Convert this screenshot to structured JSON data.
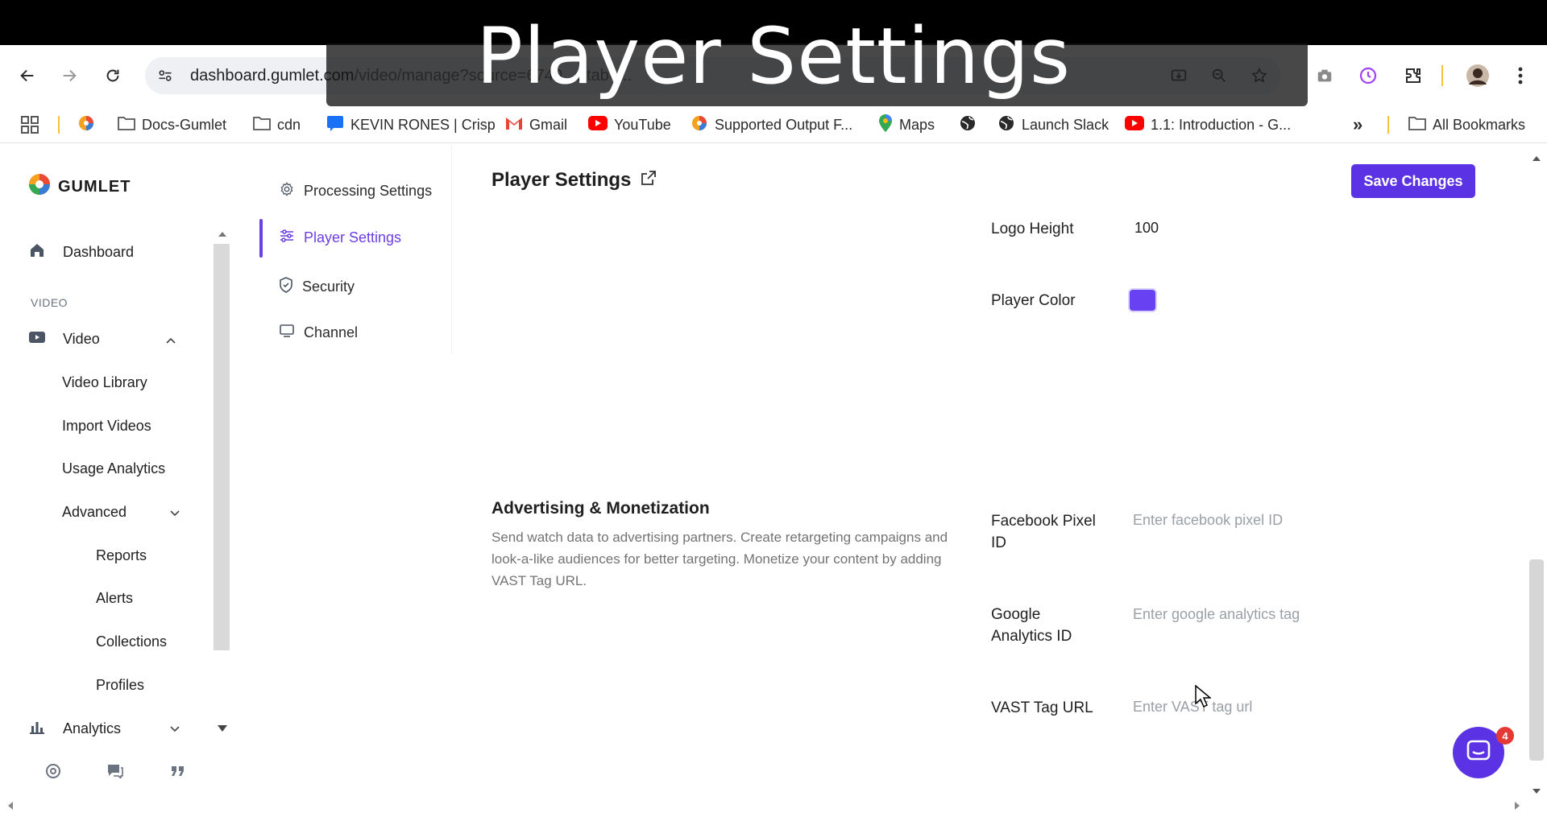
{
  "overlay": {
    "title": "Player Settings"
  },
  "browser": {
    "url_host": "dashboard.gumlet.com",
    "url_path": "/video/manage?source=6740...&tab=...",
    "bookmarks": [
      {
        "label": "",
        "icon": "chrome-icon"
      },
      {
        "label": "Docs-Gumlet",
        "icon": "folder-icon"
      },
      {
        "label": "cdn",
        "icon": "folder-icon"
      },
      {
        "label": "KEVIN RONES | Crisp",
        "icon": "crisp-icon"
      },
      {
        "label": "Gmail",
        "icon": "gmail-icon"
      },
      {
        "label": "YouTube",
        "icon": "youtube-icon"
      },
      {
        "label": "Supported Output F...",
        "icon": "gumlet-icon"
      },
      {
        "label": "Maps",
        "icon": "maps-icon"
      },
      {
        "label": "",
        "icon": "globe-icon"
      },
      {
        "label": "Launch Slack",
        "icon": "globe-icon"
      },
      {
        "label": "1.1: Introduction - G...",
        "icon": "youtube-icon"
      }
    ],
    "more_label": "»",
    "all_bookmarks": "All Bookmarks"
  },
  "sidebar": {
    "logo": "GUMLET",
    "dashboard": "Dashboard",
    "section_video": "VIDEO",
    "video": "Video",
    "video_library": "Video Library",
    "import_videos": "Import Videos",
    "usage_analytics": "Usage Analytics",
    "advanced": "Advanced",
    "reports": "Reports",
    "alerts": "Alerts",
    "collections": "Collections",
    "profiles": "Profiles",
    "analytics": "Analytics"
  },
  "subnav": {
    "processing": "Processing Settings",
    "player": "Player Settings",
    "security": "Security",
    "channel": "Channel"
  },
  "content": {
    "title": "Player Settings",
    "save_label": "Save Changes",
    "logo_height_label": "Logo Height",
    "logo_height_value": "100",
    "player_color_label": "Player Color",
    "player_color_value": "#6741f2",
    "section_title": "Advertising & Monetization",
    "section_desc": "Send watch data to advertising partners. Create retargeting campaigns and look-a-like audiences for better targeting. Monetize your content by adding VAST Tag URL.",
    "fb_label": "Facebook Pixel ID",
    "fb_placeholder": "Enter facebook pixel ID",
    "ga_label": "Google Analytics ID",
    "ga_placeholder": "Enter google analytics tag",
    "vast_label": "VAST Tag URL",
    "vast_placeholder": "Enter VAST tag url"
  },
  "chat": {
    "badge": "4"
  },
  "colors": {
    "accent": "#5b33e4",
    "active": "#6c3fe3"
  }
}
